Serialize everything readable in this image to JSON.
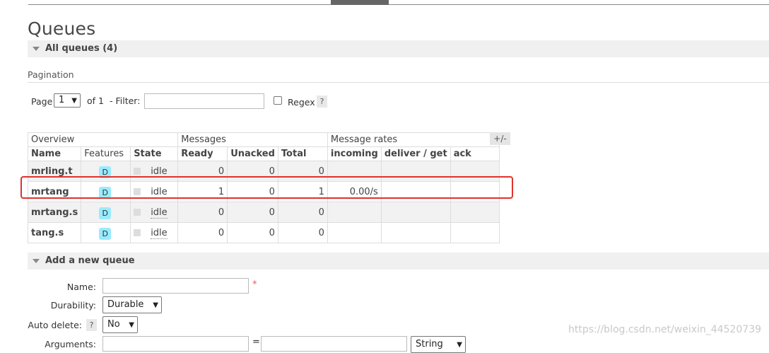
{
  "page": {
    "title": "Queues"
  },
  "all_queues": {
    "label": "All queues (4)"
  },
  "pagination": {
    "label": "Pagination",
    "page_label": "Page",
    "page_value": "1",
    "of_label": "of 1",
    "filter_label": "- Filter:",
    "filter_value": "",
    "regex_label": "Regex",
    "help_label": "?"
  },
  "table": {
    "groups": [
      "Overview",
      "Messages",
      "Message rates"
    ],
    "columns": [
      "Name",
      "Features",
      "State",
      "Ready",
      "Unacked",
      "Total",
      "incoming",
      "deliver / get",
      "ack"
    ],
    "toggle_label": "+/-",
    "rows": [
      {
        "name": "mrling.t",
        "feature": "D",
        "state": "idle",
        "ready": "0",
        "unacked": "0",
        "total": "0",
        "incoming": "",
        "deliver_get": "",
        "ack": ""
      },
      {
        "name": "mrtang",
        "feature": "D",
        "state": "idle",
        "ready": "1",
        "unacked": "0",
        "total": "1",
        "incoming": "0.00/s",
        "deliver_get": "",
        "ack": ""
      },
      {
        "name": "mrtang.s",
        "feature": "D",
        "state": "idle",
        "ready": "0",
        "unacked": "0",
        "total": "0",
        "incoming": "",
        "deliver_get": "",
        "ack": ""
      },
      {
        "name": "tang.s",
        "feature": "D",
        "state": "idle",
        "ready": "0",
        "unacked": "0",
        "total": "0",
        "incoming": "",
        "deliver_get": "",
        "ack": ""
      }
    ]
  },
  "add_queue": {
    "label": "Add a new queue",
    "name_label": "Name:",
    "name_value": "",
    "required_mark": "*",
    "durability_label": "Durability:",
    "durability_value": "Durable",
    "auto_delete_label": "Auto delete:",
    "auto_delete_help": "?",
    "auto_delete_value": "No",
    "arguments_label": "Arguments:",
    "arguments_eq": "=",
    "arguments_type": "String"
  },
  "watermark": {
    "text": "https://blog.csdn.net/weixin_44520739"
  },
  "colors": {
    "highlight": "#e0322b",
    "feature_badge": "#99ebff",
    "header_bg": "#f0f0f0"
  }
}
